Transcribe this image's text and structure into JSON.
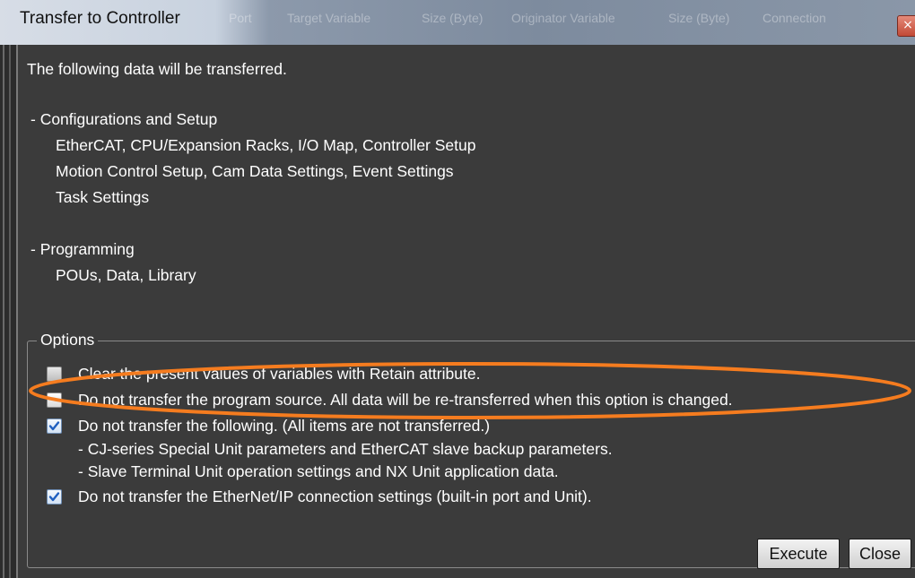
{
  "window": {
    "title": "Transfer to Controller",
    "close_glyph": "×",
    "background_tabs": [
      "Port",
      "Target Variable",
      "Size (Byte)",
      "Originator Variable",
      "Size (Byte)",
      "Connection"
    ]
  },
  "intro": "The following data will be transferred.",
  "sections": {
    "config_heading": "- Configurations and Setup",
    "config_items": [
      "EtherCAT, CPU/Expansion Racks, I/O Map, Controller Setup",
      "Motion Control Setup, Cam Data Settings, Event Settings",
      "Task Settings"
    ],
    "programming_heading": "- Programming",
    "programming_items": [
      "POUs, Data, Library"
    ]
  },
  "options": {
    "label": "Options",
    "items": [
      {
        "text": "Clear the present values of variables with Retain attribute.",
        "checked": false
      },
      {
        "text": "Do not transfer the program source. All data will be re-transferred when this option is changed.",
        "checked": false
      },
      {
        "text": "Do not transfer the following. (All items are not transferred.)",
        "checked": true
      },
      {
        "text": "Do not transfer the EtherNet/IP connection settings (built-in port and Unit).",
        "checked": true
      }
    ],
    "sub_items": [
      "- CJ-series Special Unit parameters and EtherCAT slave backup parameters.",
      "- Slave Terminal Unit operation settings and NX Unit application data."
    ]
  },
  "buttons": {
    "execute": "Execute",
    "close": "Close"
  },
  "colors": {
    "annotation": "#f57c1f",
    "checkmark": "#1f5fbf"
  }
}
